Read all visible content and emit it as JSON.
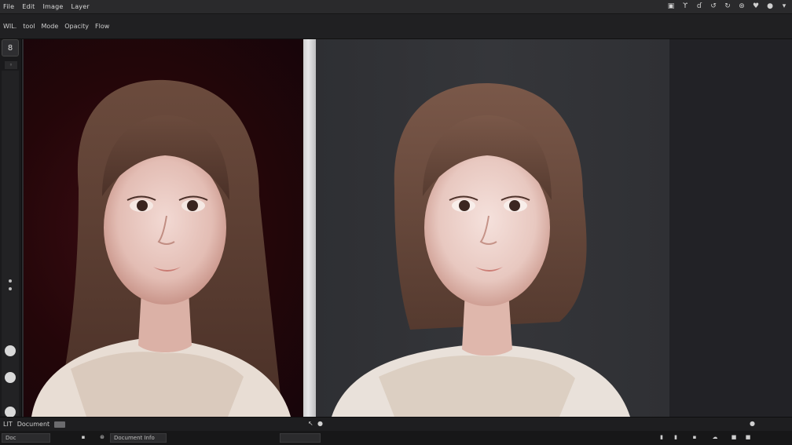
{
  "menubar": {
    "items": [
      "File",
      "Edit",
      "Image",
      "Layer"
    ],
    "tools": [
      "layers-icon",
      "brush-icon",
      "crop-icon",
      "undo-icon",
      "redo-icon",
      "settings-icon",
      "heart-icon",
      "chat-icon",
      "dropdown-icon"
    ]
  },
  "optbar": {
    "items": [
      "WIL.",
      "tool",
      "Mode",
      "Opacity",
      "Flow"
    ]
  },
  "lefttool": {
    "top_glyph": "8",
    "small_label": "◦"
  },
  "status": {
    "left_label": "LIT",
    "left_value": "Document",
    "doc_label": "Doc",
    "doc_info": "Document Info"
  },
  "colors": {
    "accent": "#2a2a2c",
    "left_bg": "#2a080d",
    "divider": "#e0e0e2"
  }
}
